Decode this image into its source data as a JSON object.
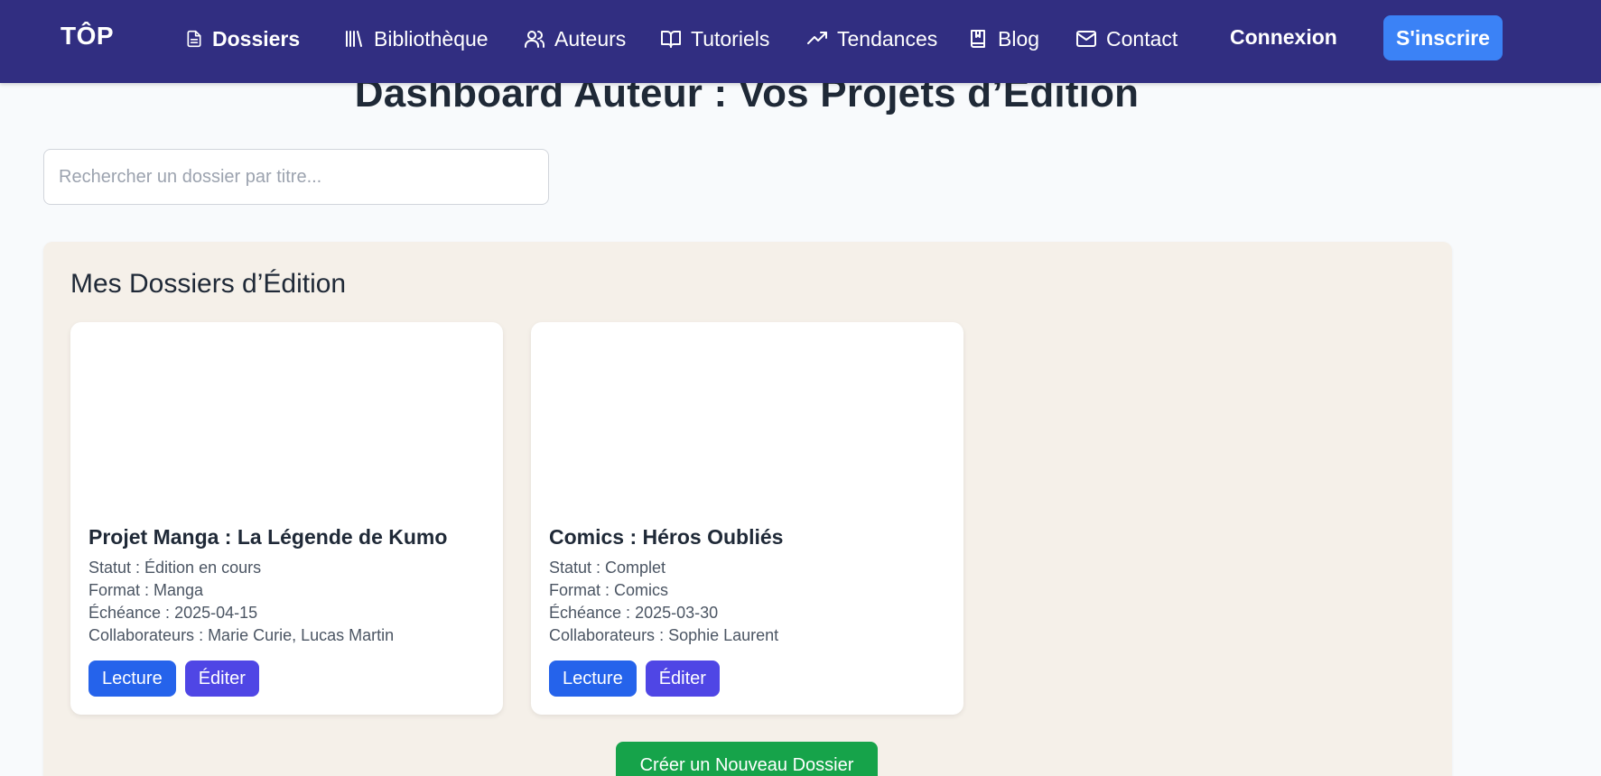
{
  "nav": {
    "logo": "TÔP",
    "items": [
      {
        "label": "Dossiers",
        "icon": "file-text-icon"
      },
      {
        "label": "Bibliothèque",
        "icon": "library-icon"
      },
      {
        "label": "Auteurs",
        "icon": "users-icon"
      },
      {
        "label": "Tutoriels",
        "icon": "book-open-icon"
      },
      {
        "label": "Tendances",
        "icon": "trending-up-icon"
      },
      {
        "label": "Blog",
        "icon": "bookmark-book-icon"
      },
      {
        "label": "Contact",
        "icon": "mail-icon"
      }
    ],
    "login": "Connexion",
    "signup": "S'inscrire"
  },
  "main": {
    "title": "Dashboard Auteur : Vos Projets d’Édition",
    "search": {
      "placeholder": "Rechercher un dossier par titre...",
      "value": ""
    }
  },
  "panel": {
    "title": "Mes Dossiers d’Édition",
    "cards": [
      {
        "title": "Projet Manga : La Légende de Kumo",
        "status": "Statut : Édition en cours",
        "format": "Format : Manga",
        "deadline": "Échéance : 2025-04-15",
        "collaborators": "Collaborateurs : Marie Curie, Lucas Martin",
        "read_label": "Lecture",
        "edit_label": "Éditer"
      },
      {
        "title": "Comics : Héros Oubliés",
        "status": "Statut : Complet",
        "format": "Format : Comics",
        "deadline": "Échéance : 2025-03-30",
        "collaborators": "Collaborateurs : Sophie Laurent",
        "read_label": "Lecture",
        "edit_label": "Éditer"
      }
    ],
    "create_label": "Créer un Nouveau Dossier"
  },
  "colors": {
    "nav_bg": "#312e81",
    "signup_bg": "#3b82f6",
    "panel_bg": "#f5f0e9",
    "read_btn": "#2563eb",
    "edit_btn": "#4f46e5",
    "create_btn": "#16a34a"
  }
}
